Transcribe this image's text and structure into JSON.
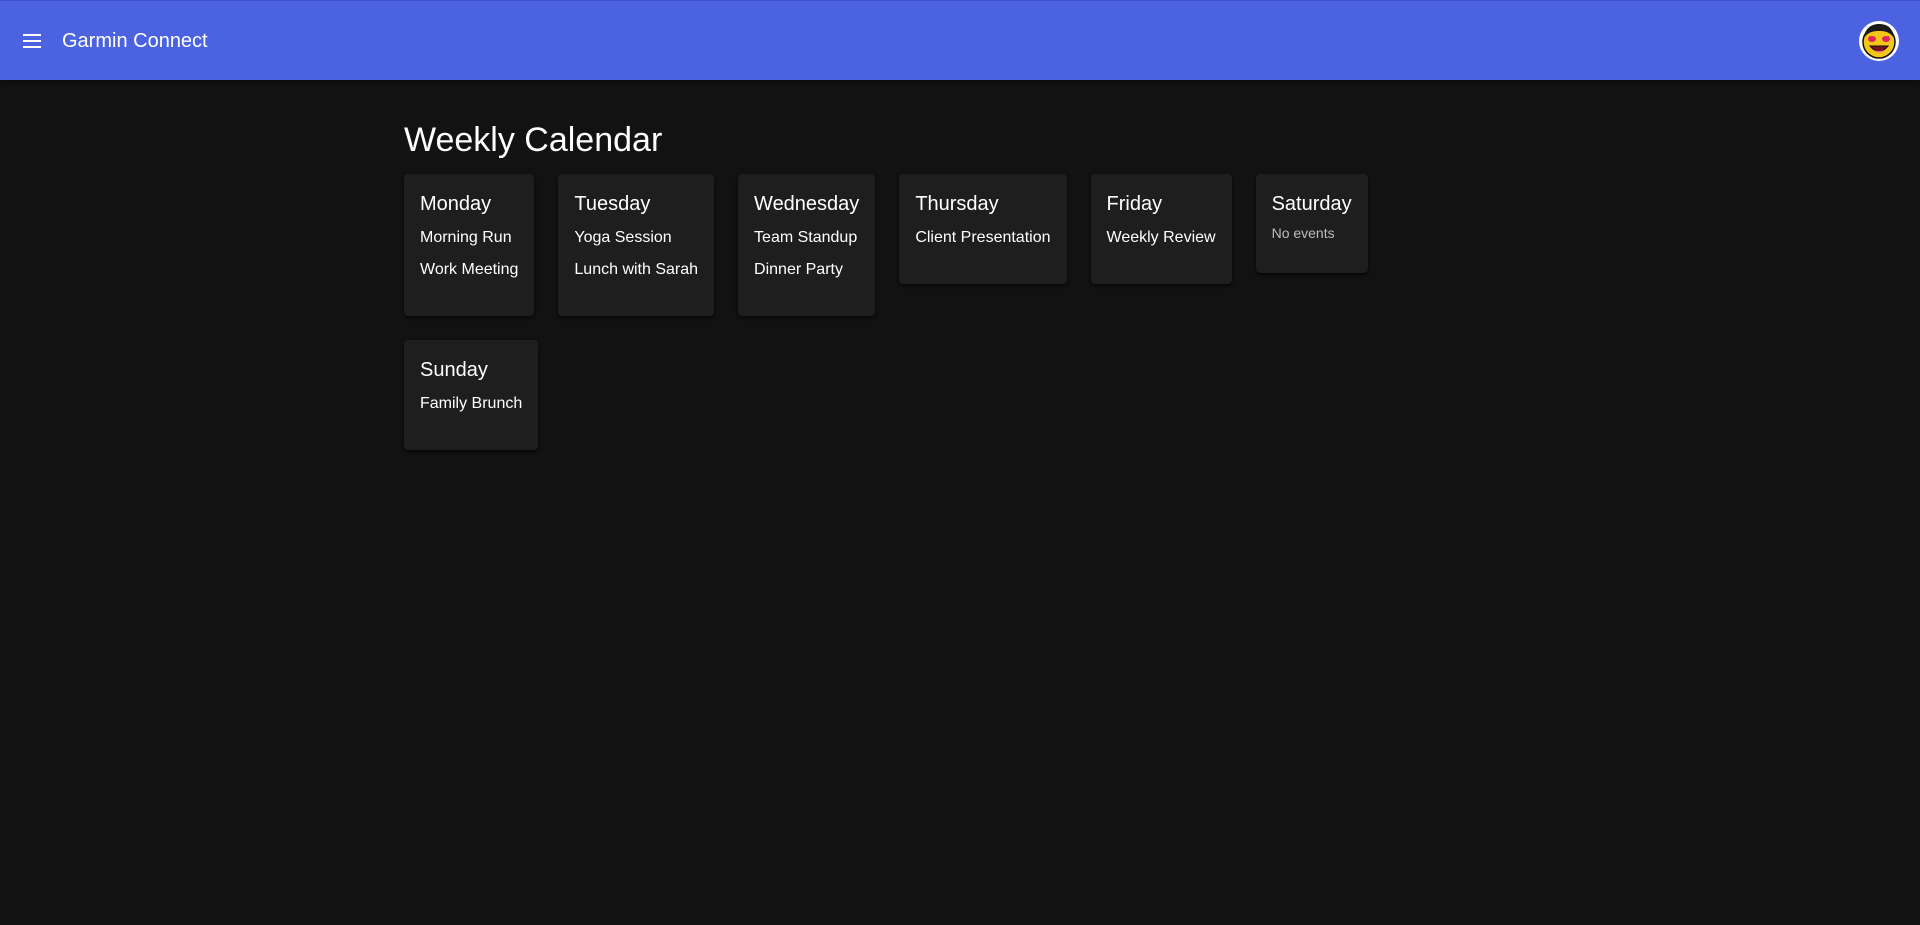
{
  "app": {
    "title": "Garmin Connect",
    "menu_icon": "menu-icon",
    "avatar_icon": "emoji-avatar-icon",
    "accent_color": "#4b63e0",
    "background_color": "#121212",
    "card_color": "#1e1e1e"
  },
  "page": {
    "title": "Weekly Calendar"
  },
  "days": [
    {
      "name": "Monday",
      "events": [
        "Morning Run",
        "Work Meeting"
      ]
    },
    {
      "name": "Tuesday",
      "events": [
        "Yoga Session",
        "Lunch with Sarah"
      ]
    },
    {
      "name": "Wednesday",
      "events": [
        "Team Standup",
        "Dinner Party"
      ]
    },
    {
      "name": "Thursday",
      "events": [
        "Client Presentation"
      ]
    },
    {
      "name": "Friday",
      "events": [
        "Weekly Review"
      ]
    },
    {
      "name": "Saturday",
      "events": [],
      "empty_text": "No events"
    },
    {
      "name": "Sunday",
      "events": [
        "Family Brunch"
      ]
    }
  ]
}
